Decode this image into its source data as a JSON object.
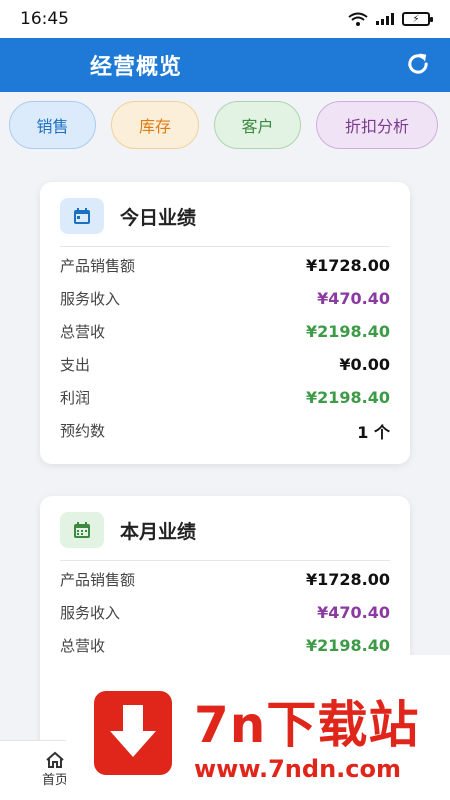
{
  "status_bar": {
    "time": "16:45"
  },
  "app_bar": {
    "title": "经营概览"
  },
  "chips": {
    "sales": "销售",
    "stock": "库存",
    "customer": "客户",
    "discount": "折扣分析"
  },
  "today": {
    "title": "今日业绩",
    "rows": [
      {
        "label": "产品销售额",
        "value": "¥1728.00"
      },
      {
        "label": "服务收入",
        "value": "¥470.40"
      },
      {
        "label": "总营收",
        "value": "¥2198.40"
      },
      {
        "label": "支出",
        "value": "¥0.00"
      },
      {
        "label": "利润",
        "value": "¥2198.40"
      },
      {
        "label": "预约数",
        "value": "1 个"
      }
    ]
  },
  "month": {
    "title": "本月业绩",
    "rows": [
      {
        "label": "产品销售额",
        "value": "¥1728.00"
      },
      {
        "label": "服务收入",
        "value": "¥470.40"
      },
      {
        "label": "总营收",
        "value": "¥2198.40"
      }
    ]
  },
  "bottom_nav": {
    "home": "首页"
  },
  "watermark": {
    "name": "7n下载站",
    "url": "www.7ndn.com"
  },
  "colors": {
    "primary": "#1e7ad6",
    "purple": "#8a3aa0",
    "green": "#3d9a46"
  }
}
